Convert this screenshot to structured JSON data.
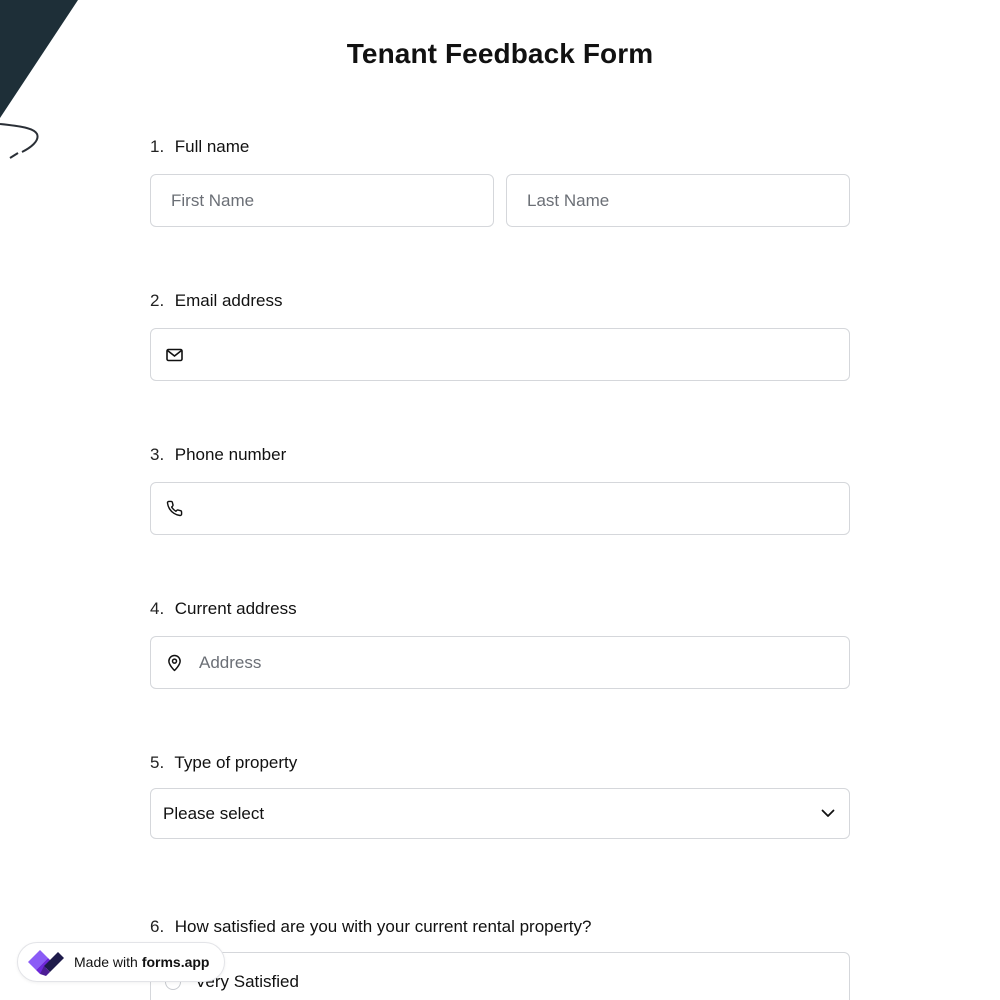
{
  "form": {
    "title": "Tenant Feedback Form",
    "accent_color": "#1e2f38"
  },
  "questions": {
    "full_name": {
      "number": "1.",
      "label": "Full name",
      "first_placeholder": "First Name",
      "last_placeholder": "Last Name"
    },
    "email": {
      "number": "2.",
      "label": "Email address",
      "icon": "mail-icon",
      "value": ""
    },
    "phone": {
      "number": "3.",
      "label": "Phone number",
      "icon": "phone-icon",
      "value": ""
    },
    "address": {
      "number": "4.",
      "label": "Current address",
      "icon": "map-pin-icon",
      "placeholder": "Address"
    },
    "property_type": {
      "number": "5.",
      "label": "Type of property",
      "selected": "Please select",
      "icon": "chevron-down-icon"
    },
    "satisfaction": {
      "number": "6.",
      "label": "How satisfied are you with your current rental property?",
      "first_option": "Very Satisfied"
    }
  },
  "badge": {
    "prefix": "Made with",
    "brand": "forms.app"
  }
}
